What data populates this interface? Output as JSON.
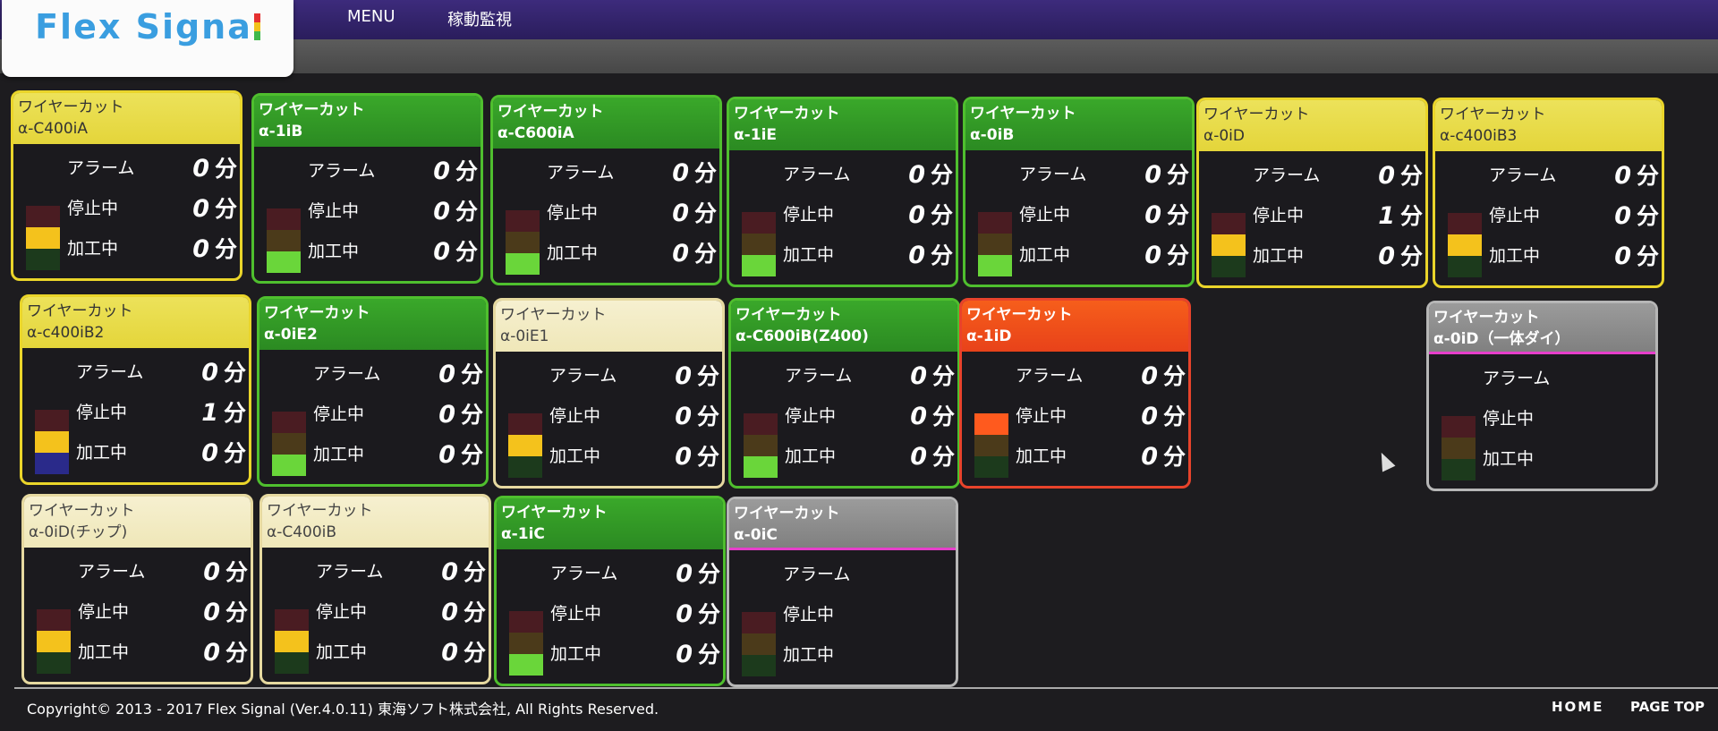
{
  "app": {
    "logo_text": "Flex Signa",
    "menu": [
      "MENU",
      "稼動監視"
    ]
  },
  "labels": {
    "alarm": "アラーム",
    "stopped": "停止中",
    "processing": "加工中",
    "unit": "分"
  },
  "cards": [
    {
      "title": "ワイヤーカット",
      "model": "α-C400iA",
      "style": "yellow",
      "alarm": "0",
      "stopped": "0",
      "processing": "0",
      "lamp": [
        "off",
        "yel",
        "off"
      ]
    },
    {
      "title": "ワイヤーカット",
      "model": "α-1iB",
      "style": "green",
      "alarm": "0",
      "stopped": "0",
      "processing": "0",
      "lamp": [
        "off",
        "off",
        "grn"
      ]
    },
    {
      "title": "ワイヤーカット",
      "model": "α-C600iA",
      "style": "green",
      "alarm": "0",
      "stopped": "0",
      "processing": "0",
      "lamp": [
        "off",
        "off",
        "grn"
      ]
    },
    {
      "title": "ワイヤーカット",
      "model": "α-1iE",
      "style": "green",
      "alarm": "0",
      "stopped": "0",
      "processing": "0",
      "lamp": [
        "off",
        "off",
        "grn"
      ]
    },
    {
      "title": "ワイヤーカット",
      "model": "α-0iB",
      "style": "green",
      "alarm": "0",
      "stopped": "0",
      "processing": "0",
      "lamp": [
        "off",
        "off",
        "grn"
      ]
    },
    {
      "title": "ワイヤーカット",
      "model": "α-0iD",
      "style": "yellow",
      "alarm": "0",
      "stopped": "1",
      "processing": "0",
      "lamp": [
        "off",
        "yel",
        "off"
      ]
    },
    {
      "title": "ワイヤーカット",
      "model": "α-c400iB3",
      "style": "yellow",
      "alarm": "0",
      "stopped": "0",
      "processing": "0",
      "lamp": [
        "off",
        "yel",
        "off"
      ]
    },
    {
      "title": "ワイヤーカット",
      "model": "α-c400iB2",
      "style": "yellow",
      "alarm": "0",
      "stopped": "1",
      "processing": "0",
      "lamp": [
        "off",
        "yel",
        "blue"
      ]
    },
    {
      "title": "ワイヤーカット",
      "model": "α-0iE2",
      "style": "green",
      "alarm": "0",
      "stopped": "0",
      "processing": "0",
      "lamp": [
        "off",
        "off",
        "grn"
      ]
    },
    {
      "title": "ワイヤーカット",
      "model": "α-0iE1",
      "style": "cream",
      "alarm": "0",
      "stopped": "0",
      "processing": "0",
      "lamp": [
        "off",
        "yel",
        "off"
      ]
    },
    {
      "title": "ワイヤーカット",
      "model": "α-C600iB(Z400)",
      "style": "green",
      "alarm": "0",
      "stopped": "0",
      "processing": "0",
      "lamp": [
        "off",
        "off",
        "grn"
      ]
    },
    {
      "title": "ワイヤーカット",
      "model": "α-1iD",
      "style": "red",
      "alarm": "0",
      "stopped": "0",
      "processing": "0",
      "lamp": [
        "red",
        "off",
        "off"
      ]
    },
    {
      "title": "ワイヤーカット",
      "model": "α-0iD（一体ダイ）",
      "style": "gray",
      "alarm": "",
      "stopped": "",
      "processing": "",
      "lamp": [
        "off",
        "off",
        "off"
      ]
    },
    {
      "title": "ワイヤーカット",
      "model": "α-0iD(チップ)",
      "style": "cream",
      "alarm": "0",
      "stopped": "0",
      "processing": "0",
      "lamp": [
        "off",
        "yel",
        "off"
      ]
    },
    {
      "title": "ワイヤーカット",
      "model": "α-C400iB",
      "style": "cream",
      "alarm": "0",
      "stopped": "0",
      "processing": "0",
      "lamp": [
        "off",
        "yel",
        "off"
      ]
    },
    {
      "title": "ワイヤーカット",
      "model": "α-1iC",
      "style": "green",
      "alarm": "0",
      "stopped": "0",
      "processing": "0",
      "lamp": [
        "off",
        "off",
        "grn"
      ]
    },
    {
      "title": "ワイヤーカット",
      "model": "α-0iC",
      "style": "gray",
      "alarm": "",
      "stopped": "",
      "processing": "",
      "lamp": [
        "off",
        "off",
        "off"
      ]
    }
  ],
  "footer": {
    "copyright": "Copyright© 2013 - 2017  Flex Signal (Ver.4.0.11) 東海ソフト株式会社, All Rights Reserved.",
    "home": "HOME",
    "page_top": "PAGE TOP"
  }
}
